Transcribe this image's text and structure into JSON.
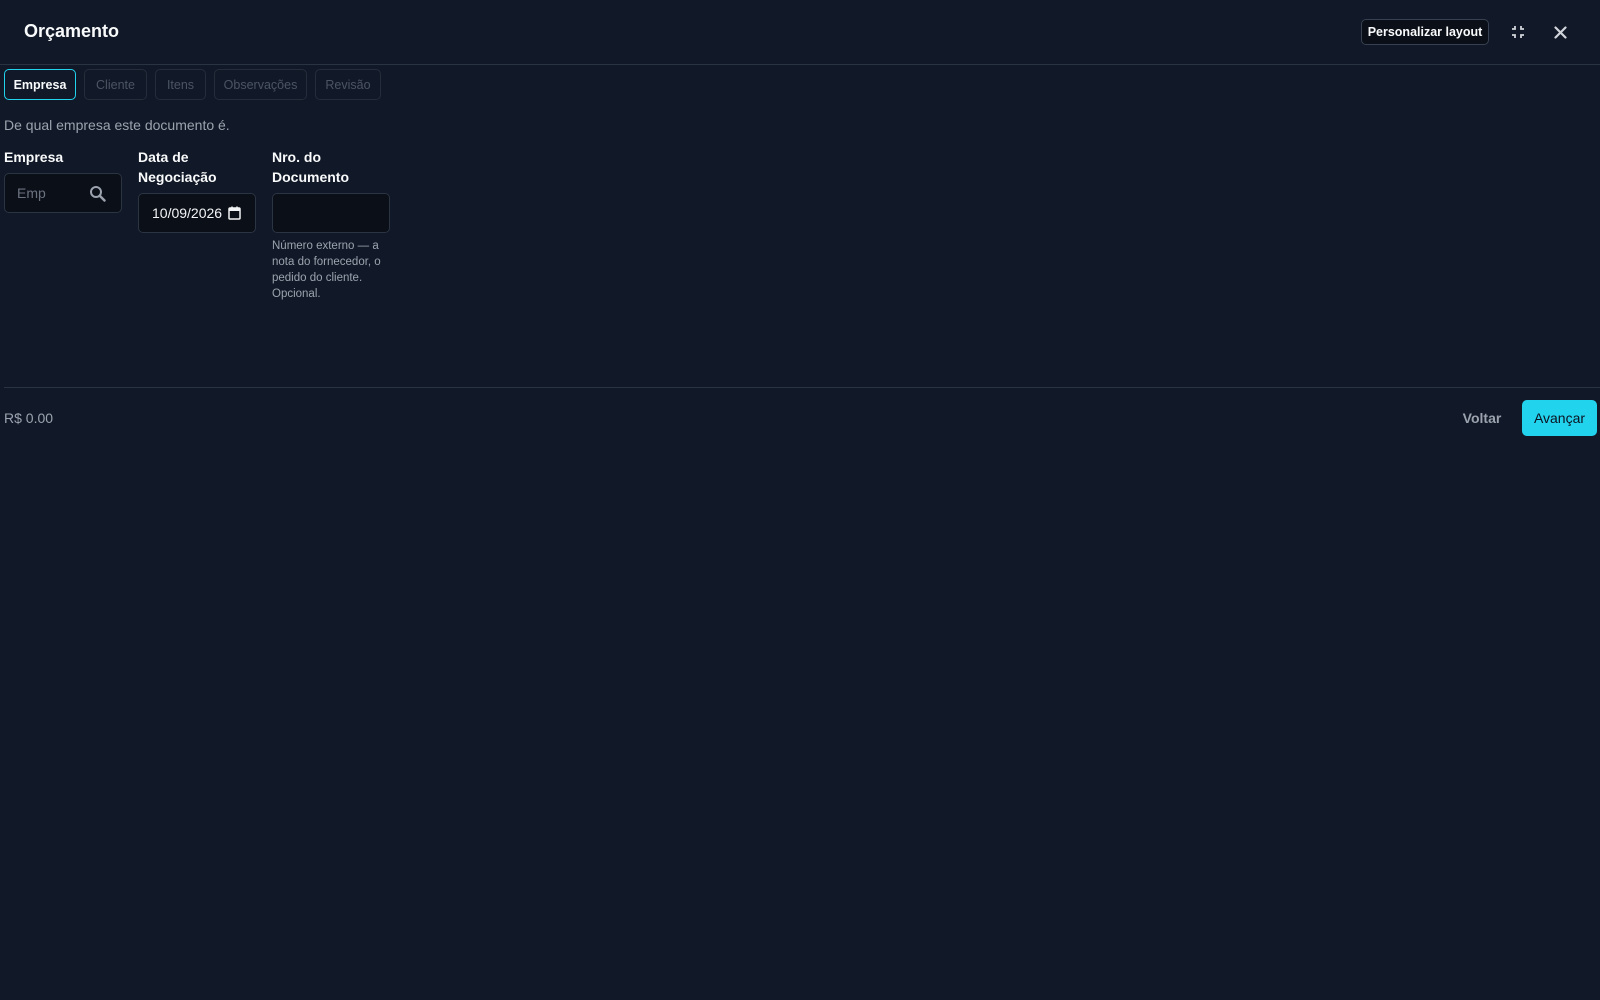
{
  "header": {
    "title": "Orçamento",
    "layout_button": "Personalizar layout",
    "minimize_icon": "minimize-icon",
    "close_icon": "close-icon"
  },
  "tabs": [
    {
      "label": "Empresa",
      "active": true
    },
    {
      "label": "Cliente",
      "active": false
    },
    {
      "label": "Itens",
      "active": false
    },
    {
      "label": "Observações",
      "active": false
    },
    {
      "label": "Revisão",
      "active": false
    }
  ],
  "step": {
    "subtitle": "De qual empresa este documento é."
  },
  "form": {
    "empresa": {
      "label": "Empresa",
      "placeholder": "Emp",
      "icon": "search-icon"
    },
    "data_negociacao": {
      "label_line1": "Data de",
      "label_line2": "Negociação",
      "value": "10/09/2026",
      "icon": "calendar-icon"
    },
    "nro_documento": {
      "label_line1": "Nro. do",
      "label_line2": "Documento",
      "value": "",
      "help": "Número externo — a nota do fornecedor, o pedido do cliente. Opcional."
    }
  },
  "footer": {
    "total": "R$ 0.00",
    "back_label": "Voltar",
    "next_label": "Avançar"
  },
  "colors": {
    "background": "#111827",
    "accent": "#22d3ee"
  }
}
